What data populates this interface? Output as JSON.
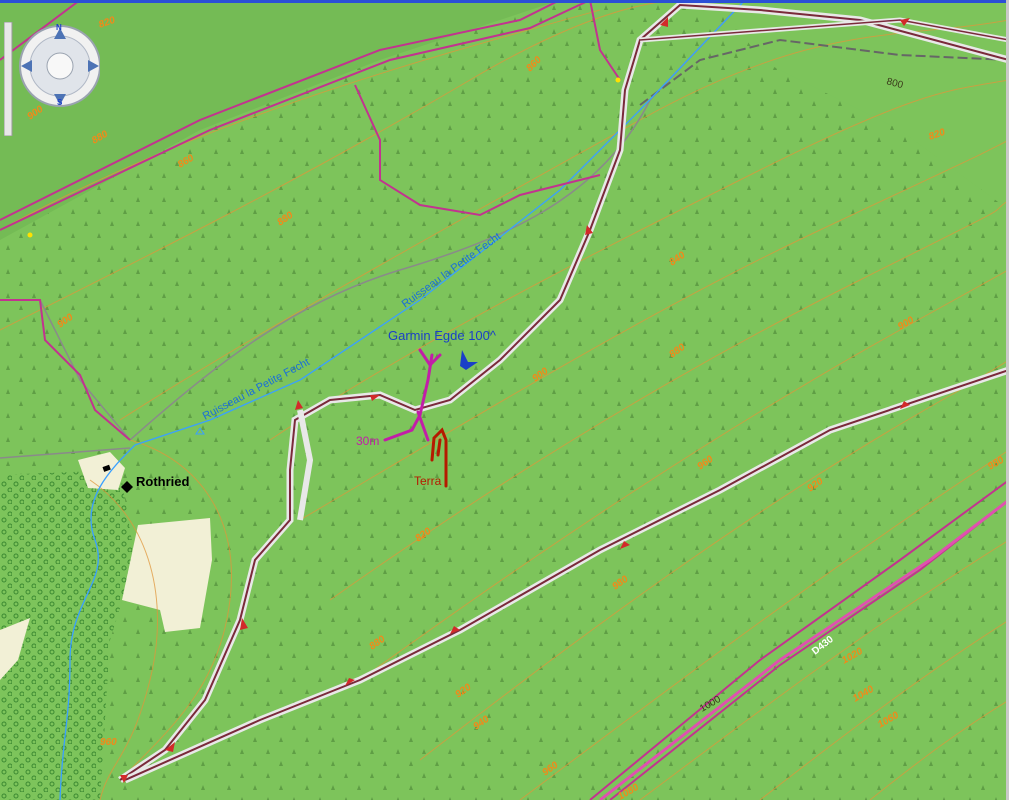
{
  "place": {
    "name": "Rothried"
  },
  "stream": {
    "label_1": "Ruisseau la Petite Fecht",
    "label_2": "Ruisseau la Petite Fecht"
  },
  "annotations": {
    "device": "Garmin Egde 100",
    "device_suffix": "^",
    "distance": "30m",
    "terrain": "Terra"
  },
  "contours": {
    "labels": [
      "820",
      "880",
      "860",
      "880",
      "900",
      "900",
      "860",
      "820",
      "800",
      "840",
      "880",
      "900",
      "980",
      "960",
      "920",
      "900",
      "820",
      "880",
      "920",
      "940",
      "960",
      "980",
      "1000",
      "1020",
      "1040",
      "1060",
      "1080",
      "960"
    ]
  },
  "road_label": "D430",
  "navigation": {
    "north": "N",
    "south": "S",
    "icon_names": [
      "pan-up-icon",
      "pan-down-icon",
      "pan-left-icon",
      "pan-right-icon",
      "pan-center-icon"
    ]
  },
  "colors": {
    "forest": "#7dc45b",
    "forest_dark": "#6ab447",
    "clearing": "#f2f0d6",
    "track": "#7a2a3a",
    "road_pink": "#c2338f",
    "stream": "#3aa0ff",
    "contour": "#e0963a",
    "device_text": "#1a3fc8",
    "distance_text": "#c21ea8",
    "terrain_text": "#b51a00"
  }
}
